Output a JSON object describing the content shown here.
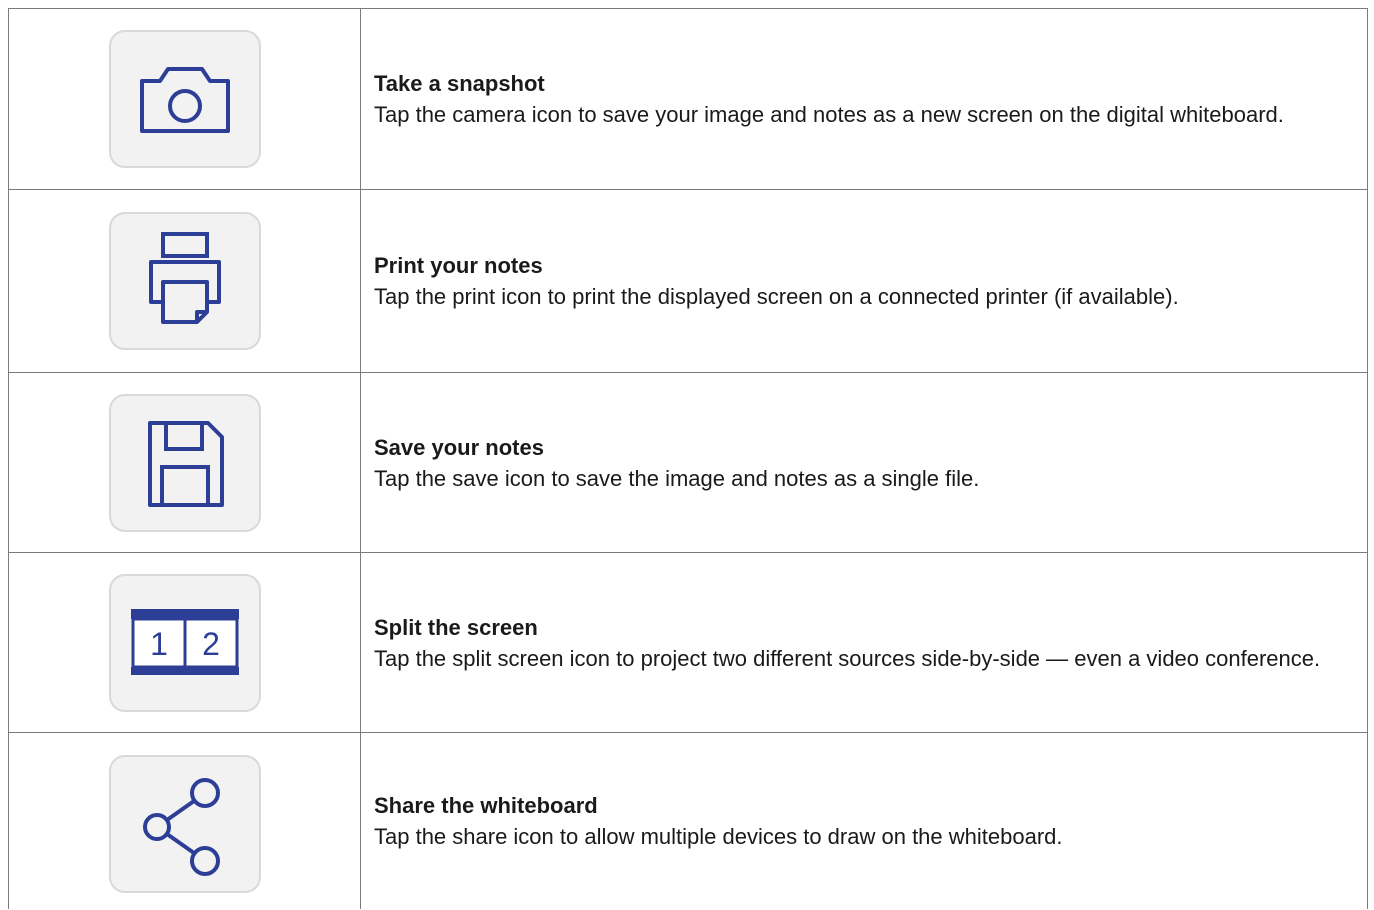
{
  "rows": [
    {
      "title": "Take a snapshot",
      "description": "Tap the camera icon to save your image and notes as a new screen on the digital whiteboard.",
      "icon": "camera-icon"
    },
    {
      "title": "Print your notes",
      "description": "Tap the print icon to print the displayed screen on a connected printer (if available).",
      "icon": "printer-icon"
    },
    {
      "title": "Save your notes",
      "description": "Tap the save icon to save the image and notes as a single file.",
      "icon": "floppy-disk-icon"
    },
    {
      "title": "Split the screen",
      "description": "Tap the split screen icon to project two different sources side-by-side — even a video conference.",
      "icon": "split-screen-icon",
      "pane_labels": [
        "1",
        "2"
      ]
    },
    {
      "title": "Share the whiteboard",
      "description": "Tap the share icon to allow multiple devices to draw on the whiteboard.",
      "icon": "share-icon"
    }
  ],
  "colors": {
    "icon_stroke": "#2c3e96",
    "icon_background": "#f2f2f2",
    "border": "#7a7a7a"
  }
}
